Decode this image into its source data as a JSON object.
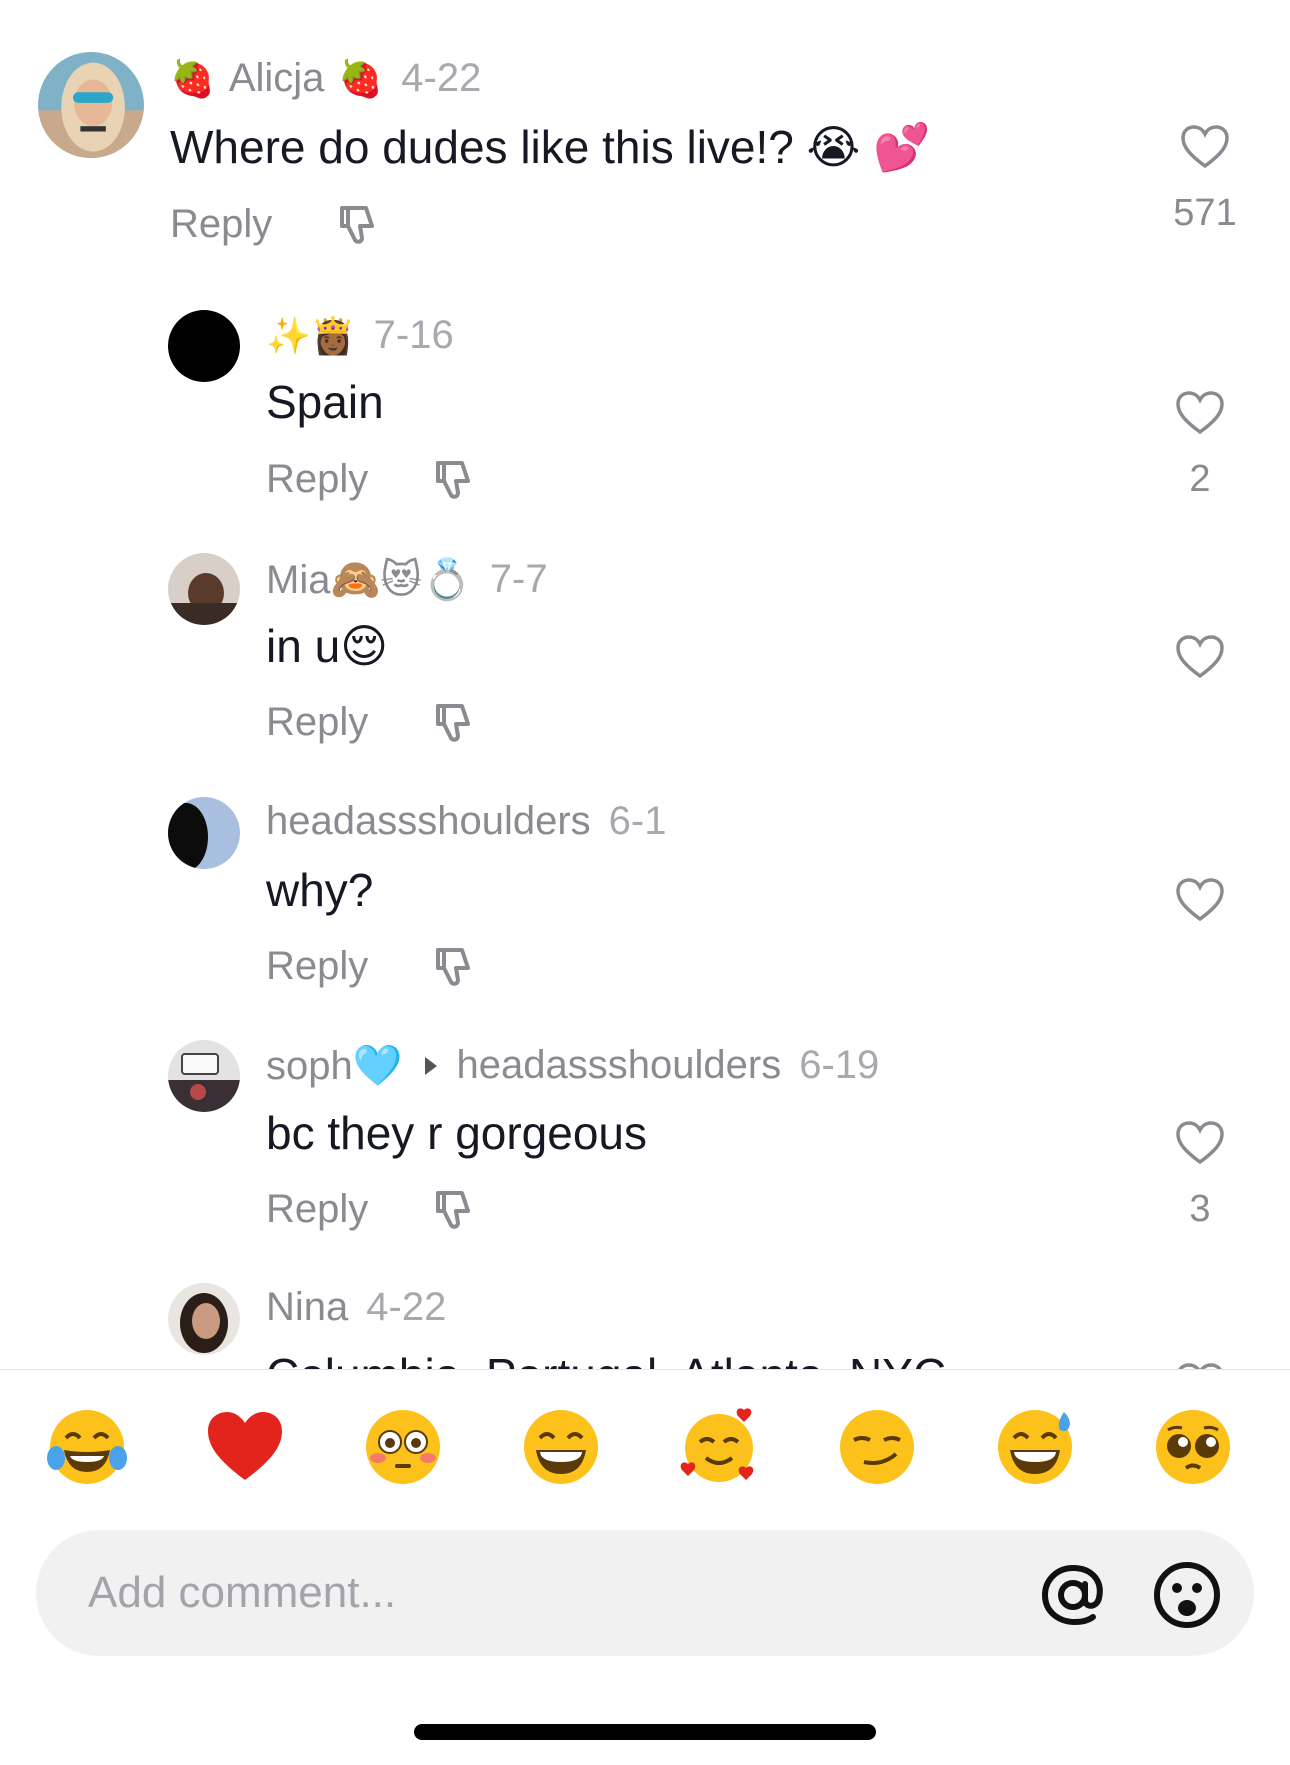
{
  "comments": [
    {
      "username": "Alicja",
      "prefix_emoji": "🍓",
      "suffix_emoji": "🍓",
      "date": "4-22",
      "text": "Where do dudes like this live!? 😭 💕",
      "reply_label": "Reply",
      "like_count": "571"
    },
    {
      "username": "✨👸🏾",
      "date": "7-16",
      "text": "Spain",
      "reply_label": "Reply",
      "like_count": "2"
    },
    {
      "username": "Mia🙈😻💍",
      "date": "7-7",
      "text": "in u😌",
      "reply_label": "Reply",
      "like_count": ""
    },
    {
      "username": "headassshoulders",
      "date": "6-1",
      "text": "why?",
      "reply_label": "Reply",
      "like_count": ""
    },
    {
      "username": "soph🩵",
      "reply_to": "headassshoulders",
      "date": "6-19",
      "text": "bc they r gorgeous",
      "reply_label": "Reply",
      "like_count": "3"
    },
    {
      "username": "Nina",
      "date": "4-22",
      "text": "Columbia, Portugal, Atlanta, NYC"
    }
  ],
  "quick_emojis": [
    "😂",
    "❤️",
    "😳",
    "😁",
    "🥰",
    "😏",
    "😅",
    "🥺"
  ],
  "composer": {
    "placeholder": "Add comment..."
  },
  "icons": {
    "like": "heart-outline-icon",
    "dislike": "thumbs-down-icon",
    "mention": "at-sign-icon",
    "emoji": "emoji-face-icon"
  }
}
